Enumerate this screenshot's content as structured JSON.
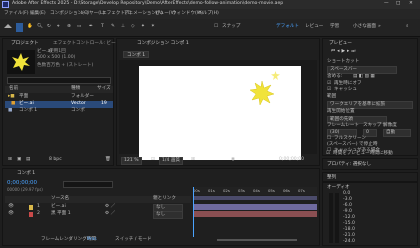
{
  "window": {
    "title": "Adobe After Effects 2025 - D:\\Storage\\Develop Repository\\Demo\\AfterEffects\\demo-follow-animation\\demo-movie.aep"
  },
  "menu": [
    "ファイル(F)",
    "編集(E)",
    "コンポジション(C)",
    "レイヤー(L)",
    "エフェクト(T)",
    "アニメーション(A)",
    "ビュー(V)",
    "ウィンドウ(W)",
    "ヘルプ(H)"
  ],
  "toolbar": {
    "snap_label": "スナップ",
    "workspaces": [
      "デフォルト",
      "レビュー",
      "学習",
      "小さな画面"
    ]
  },
  "project": {
    "tab_project": "プロジェクト",
    "tab_effects": "エフェクトコントロール: ビー",
    "thumb_title": "ビー.ai",
    "thumb_sub": "使用1回",
    "thumb_info1": "500 x 500 (1.00)",
    "thumb_info2": "色数百万色 + (ストレート)",
    "col_name": "名前",
    "col_type": "種類",
    "col_size": "サイズ",
    "items": [
      {
        "name": "平面",
        "type": "フォルダー",
        "size": ""
      },
      {
        "name": "ビー.ai",
        "type": "Vector",
        "size": "19"
      },
      {
        "name": "コンポ 1",
        "type": "コンポ",
        "size": ""
      }
    ],
    "bpc": "8 bpc"
  },
  "comp": {
    "tab": "コンポジション コンポ 1",
    "subtab": "コンポ 1",
    "zoom": "121 %",
    "quality": "1/4 画質",
    "timecode": "0;00;00;00"
  },
  "right": {
    "preview_tab": "プレビュー",
    "shortcut_label": "ショートカット",
    "shortcut_value": "スペースバー",
    "include_label": "含める:",
    "media_label": "再生時にオフ",
    "cache_label": "キャッシュ",
    "range_label": "範囲",
    "range_value": "ワークエリアを基準に拡張",
    "playfrom_label": "再生開始位置",
    "playfrom_value": "範囲の先頭",
    "frame_label": "フレームレート",
    "skip_label": "スキップ",
    "res_label": "解像度",
    "frame_value": "(30)",
    "skip_value": "0",
    "res_value": "自動",
    "fullscreen_label": "フルスクリーン",
    "stop_label": "(スペースバー) で停止時",
    "opt1": "キャッシュがある場合",
    "opt2": "時間をプレビュー時間に移動",
    "props_tab": "プロパティ: 選択なし",
    "align_tab": "整列",
    "audio_tab": "オーディオ",
    "audio_marks": [
      "0.0",
      "-3.0",
      "-6.0",
      "-9.0",
      "-12.0",
      "-15.0",
      "-18.0",
      "-21.0",
      "-24.0"
    ]
  },
  "timeline": {
    "tab": "コンポ 1",
    "timecode": "0;00;00;00",
    "fps": "00000 (29.97 fps)",
    "col_name": "ソース名",
    "col_parent": "親とリンク",
    "layers": [
      {
        "num": "1",
        "name": "ビー.ai",
        "parent": "なし",
        "color": "#d9b84a"
      },
      {
        "num": "2",
        "name": "黒 平面 1",
        "parent": "なし",
        "color": "#c94a4a"
      }
    ],
    "ruler": [
      "00s",
      "01s",
      "02s",
      "03s",
      "04s",
      "05s",
      "06s",
      "07s",
      "08s"
    ],
    "footer_left": "フレームレンダリング時間",
    "footer_time": "9ms",
    "footer_toggle": "スイッチ / モード"
  },
  "colors": {
    "accent": "#4aa3ff",
    "star": "#f1e33a",
    "layer_bar": "#6f6a9e"
  }
}
